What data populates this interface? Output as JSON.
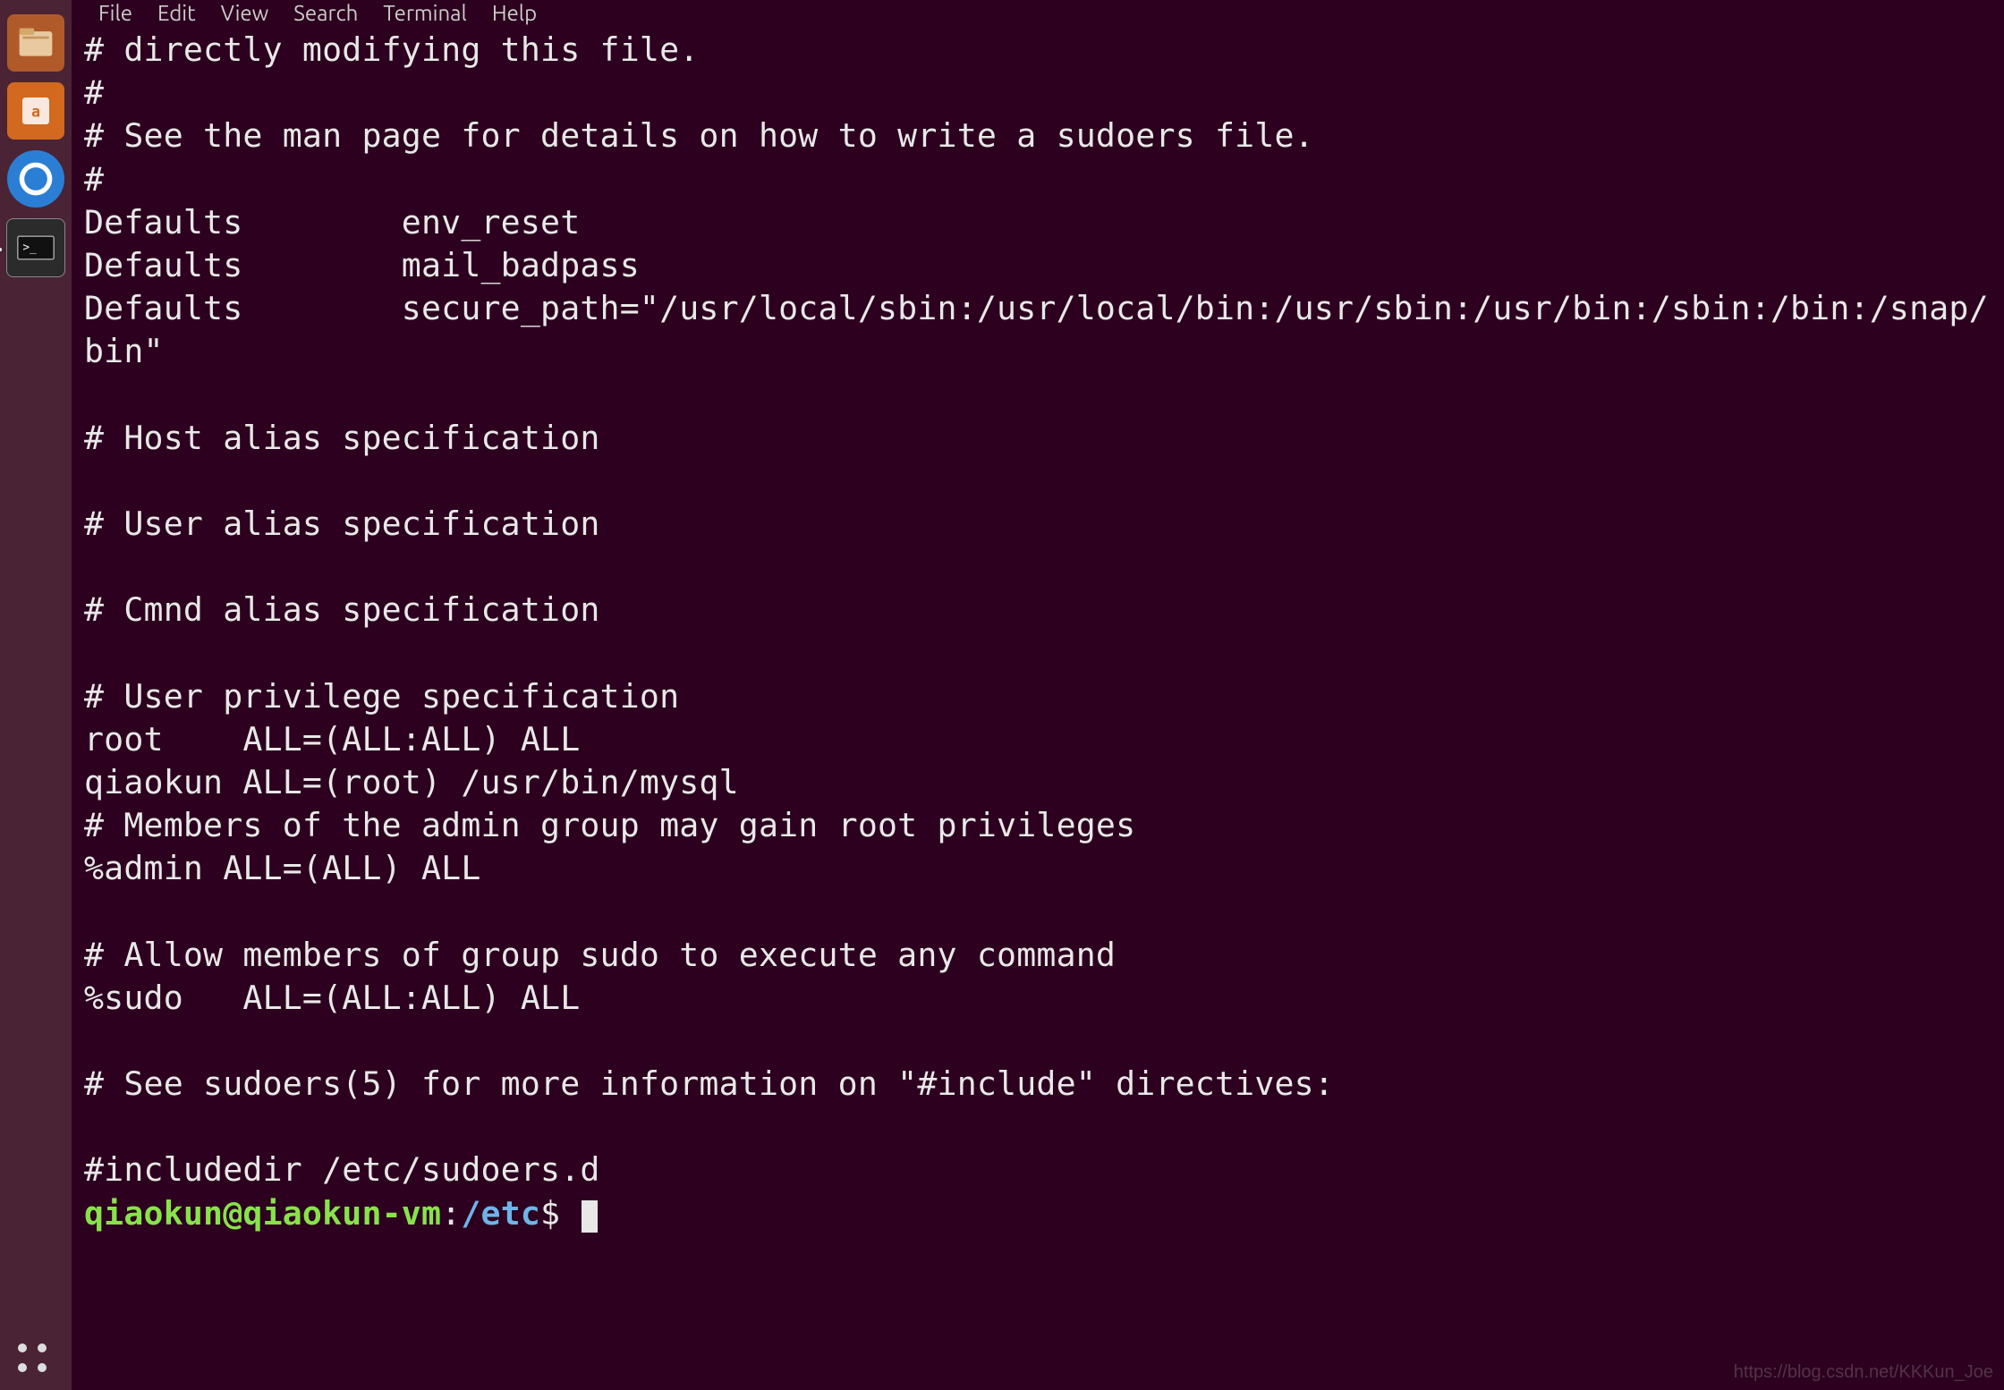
{
  "menubar": {
    "file": "File",
    "edit": "Edit",
    "view": "View",
    "search": "Search",
    "terminal": "Terminal",
    "help": "Help"
  },
  "terminal": {
    "lines": [
      "# directly modifying this file.",
      "#",
      "# See the man page for details on how to write a sudoers file.",
      "#",
      "Defaults        env_reset",
      "Defaults        mail_badpass",
      "Defaults        secure_path=\"/usr/local/sbin:/usr/local/bin:/usr/sbin:/usr/bin:/sbin:/bin:/snap/bin\"",
      "",
      "# Host alias specification",
      "",
      "# User alias specification",
      "",
      "# Cmnd alias specification",
      "",
      "# User privilege specification",
      "root    ALL=(ALL:ALL) ALL",
      "qiaokun ALL=(root) /usr/bin/mysql",
      "# Members of the admin group may gain root privileges",
      "%admin ALL=(ALL) ALL",
      "",
      "# Allow members of group sudo to execute any command",
      "%sudo   ALL=(ALL:ALL) ALL",
      "",
      "# See sudoers(5) for more information on \"#include\" directives:",
      "",
      "#includedir /etc/sudoers.d"
    ],
    "prompt": {
      "user": "qiaokun@qiaokun-vm",
      "colon": ":",
      "path": "/etc",
      "symbol": "$ "
    }
  },
  "watermark": "https://blog.csdn.net/KKKun_Joe",
  "launcher": {
    "items": [
      {
        "name": "files-icon"
      },
      {
        "name": "app-icon"
      },
      {
        "name": "browser-icon"
      },
      {
        "name": "terminal-icon"
      }
    ]
  }
}
